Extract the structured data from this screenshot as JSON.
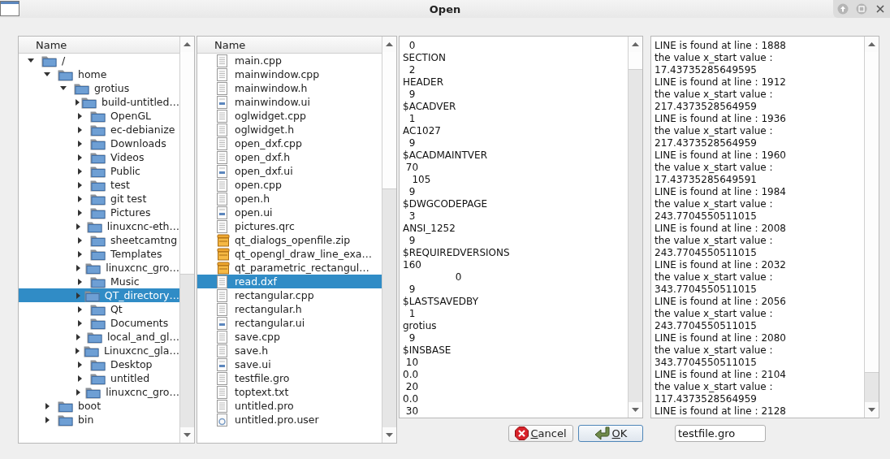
{
  "window": {
    "title": "Open"
  },
  "folder_tree": {
    "column": "Name",
    "items": [
      {
        "label": "/",
        "expanded": true,
        "selected": false,
        "children": [
          {
            "label": "home",
            "expanded": true,
            "selected": false,
            "children": [
              {
                "label": "grotius",
                "expanded": true,
                "selected": false,
                "children": [
                  {
                    "label": "build-untitled…",
                    "expanded": false,
                    "selected": false
                  },
                  {
                    "label": "OpenGL",
                    "expanded": false,
                    "selected": false
                  },
                  {
                    "label": "ec-debianize",
                    "expanded": false,
                    "selected": false
                  },
                  {
                    "label": "Downloads",
                    "expanded": false,
                    "selected": false
                  },
                  {
                    "label": "Videos",
                    "expanded": false,
                    "selected": false
                  },
                  {
                    "label": "Public",
                    "expanded": false,
                    "selected": false
                  },
                  {
                    "label": "test",
                    "expanded": false,
                    "selected": false
                  },
                  {
                    "label": "git test",
                    "expanded": false,
                    "selected": false
                  },
                  {
                    "label": "Pictures",
                    "expanded": false,
                    "selected": false
                  },
                  {
                    "label": "linuxcnc-eth…",
                    "expanded": false,
                    "selected": false
                  },
                  {
                    "label": "sheetcamtng",
                    "expanded": false,
                    "selected": false
                  },
                  {
                    "label": "Templates",
                    "expanded": false,
                    "selected": false
                  },
                  {
                    "label": "linuxcnc_gro…",
                    "expanded": false,
                    "selected": false
                  },
                  {
                    "label": "Music",
                    "expanded": false,
                    "selected": false
                  },
                  {
                    "label": "QT_directory…",
                    "expanded": false,
                    "selected": true
                  },
                  {
                    "label": "Qt",
                    "expanded": false,
                    "selected": false
                  },
                  {
                    "label": "Documents",
                    "expanded": false,
                    "selected": false
                  },
                  {
                    "label": "local_and_gl…",
                    "expanded": false,
                    "selected": false
                  },
                  {
                    "label": "Linuxcnc_gla…",
                    "expanded": false,
                    "selected": false
                  },
                  {
                    "label": "Desktop",
                    "expanded": false,
                    "selected": false
                  },
                  {
                    "label": "untitled",
                    "expanded": false,
                    "selected": false
                  },
                  {
                    "label": "linuxcnc_gro…",
                    "expanded": false,
                    "selected": false
                  }
                ]
              }
            ]
          },
          {
            "label": "boot",
            "expanded": false,
            "selected": false
          },
          {
            "label": "bin",
            "expanded": false,
            "selected": false
          }
        ]
      }
    ]
  },
  "file_list": {
    "column": "Name",
    "items": [
      {
        "label": "main.cpp",
        "kind": "text",
        "selected": false
      },
      {
        "label": "mainwindow.cpp",
        "kind": "text",
        "selected": false
      },
      {
        "label": "mainwindow.h",
        "kind": "text",
        "selected": false
      },
      {
        "label": "mainwindow.ui",
        "kind": "form",
        "selected": false
      },
      {
        "label": "oglwidget.cpp",
        "kind": "text",
        "selected": false
      },
      {
        "label": "oglwidget.h",
        "kind": "text",
        "selected": false
      },
      {
        "label": "open_dxf.cpp",
        "kind": "text",
        "selected": false
      },
      {
        "label": "open_dxf.h",
        "kind": "text",
        "selected": false
      },
      {
        "label": "open_dxf.ui",
        "kind": "form",
        "selected": false
      },
      {
        "label": "open.cpp",
        "kind": "text",
        "selected": false
      },
      {
        "label": "open.h",
        "kind": "text",
        "selected": false
      },
      {
        "label": "open.ui",
        "kind": "form",
        "selected": false
      },
      {
        "label": "pictures.qrc",
        "kind": "text",
        "selected": false
      },
      {
        "label": "qt_dialogs_openfile.zip",
        "kind": "archive",
        "selected": false
      },
      {
        "label": "qt_opengl_draw_line_exa…",
        "kind": "archive",
        "selected": false
      },
      {
        "label": "qt_parametric_rectangul…",
        "kind": "archive",
        "selected": false
      },
      {
        "label": "read.dxf",
        "kind": "text",
        "selected": true
      },
      {
        "label": "rectangular.cpp",
        "kind": "text",
        "selected": false
      },
      {
        "label": "rectangular.h",
        "kind": "text",
        "selected": false
      },
      {
        "label": "rectangular.ui",
        "kind": "form",
        "selected": false
      },
      {
        "label": "save.cpp",
        "kind": "text",
        "selected": false
      },
      {
        "label": "save.h",
        "kind": "text",
        "selected": false
      },
      {
        "label": "save.ui",
        "kind": "form",
        "selected": false
      },
      {
        "label": "testfile.gro",
        "kind": "text",
        "selected": false
      },
      {
        "label": "toptext.txt",
        "kind": "text",
        "selected": false
      },
      {
        "label": "untitled.pro",
        "kind": "text",
        "selected": false
      },
      {
        "label": "untitled.pro.user",
        "kind": "settings",
        "selected": false
      }
    ]
  },
  "file_contents": {
    "lines": [
      "  0",
      "SECTION",
      "  2",
      "HEADER",
      "  9",
      "$ACADVER",
      "  1",
      "AC1027",
      "  9",
      "$ACADMAINTVER",
      " 70",
      "   105",
      "  9",
      "$DWGCODEPAGE",
      "  3",
      "ANSI_1252",
      "  9",
      "$REQUIREDVERSIONS",
      "160",
      "                 0",
      "  9",
      "$LASTSAVEDBY",
      "  1",
      "grotius",
      "  9",
      "$INSBASE",
      " 10",
      "0.0",
      " 20",
      "0.0",
      " 30"
    ]
  },
  "log": {
    "lines": [
      "LINE is found at line : 1888",
      "the value x_start value :",
      "17.43735285649595",
      "LINE is found at line : 1912",
      "the value x_start value :",
      "217.4373528564959",
      "LINE is found at line : 1936",
      "the value x_start value :",
      "217.4373528564959",
      "LINE is found at line : 1960",
      "the value x_start value :",
      "17.43735285649591",
      "LINE is found at line : 1984",
      "the value x_start value :",
      "243.7704550511015",
      "LINE is found at line : 2008",
      "the value x_start value :",
      "243.7704550511015",
      "LINE is found at line : 2032",
      "the value x_start value :",
      "343.7704550511015",
      "LINE is found at line : 2056",
      "the value x_start value :",
      "243.7704550511015",
      "LINE is found at line : 2080",
      "the value x_start value :",
      "343.7704550511015",
      "LINE is found at line : 2104",
      "the value x_start value :",
      "117.4373528564959",
      "LINE is found at line : 2128"
    ]
  },
  "buttons": [
    {
      "label": "Cancel",
      "kind": "cancel",
      "default": false
    },
    {
      "label": "OK",
      "kind": "ok",
      "default": true
    }
  ],
  "filename_field": {
    "value": "testfile.gro"
  }
}
